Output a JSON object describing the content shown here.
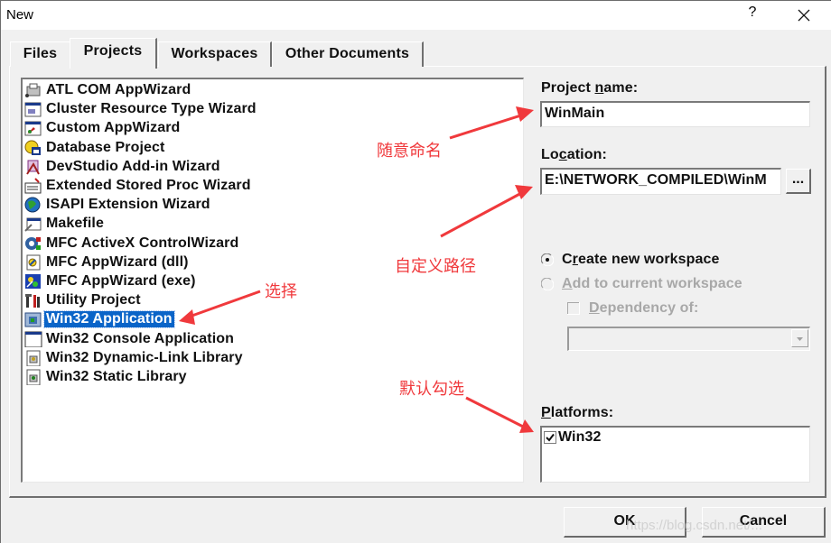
{
  "window": {
    "title": "New",
    "help_glyph": "?",
    "close_icon": "close-icon"
  },
  "tabs": [
    {
      "label": "Files",
      "active": false
    },
    {
      "label": "Projects",
      "active": true
    },
    {
      "label": "Workspaces",
      "active": false
    },
    {
      "label": "Other Documents",
      "active": false
    }
  ],
  "project_types": [
    {
      "label": "ATL COM AppWizard",
      "icon": "atl-com-icon",
      "selected": false
    },
    {
      "label": "Cluster Resource Type Wizard",
      "icon": "cluster-resource-icon",
      "selected": false
    },
    {
      "label": "Custom AppWizard",
      "icon": "custom-appwizard-icon",
      "selected": false
    },
    {
      "label": "Database Project",
      "icon": "database-project-icon",
      "selected": false
    },
    {
      "label": "DevStudio Add-in Wizard",
      "icon": "devstudio-addin-icon",
      "selected": false
    },
    {
      "label": "Extended Stored Proc Wizard",
      "icon": "stored-proc-icon",
      "selected": false
    },
    {
      "label": "ISAPI Extension Wizard",
      "icon": "isapi-globe-icon",
      "selected": false
    },
    {
      "label": "Makefile",
      "icon": "makefile-icon",
      "selected": false
    },
    {
      "label": "MFC ActiveX ControlWizard",
      "icon": "mfc-activex-icon",
      "selected": false
    },
    {
      "label": "MFC AppWizard (dll)",
      "icon": "mfc-dll-icon",
      "selected": false
    },
    {
      "label": "MFC AppWizard (exe)",
      "icon": "mfc-exe-icon",
      "selected": false
    },
    {
      "label": "Utility Project",
      "icon": "utility-tools-icon",
      "selected": false
    },
    {
      "label": "Win32 Application",
      "icon": "win32-app-icon",
      "selected": true
    },
    {
      "label": "Win32 Console Application",
      "icon": "console-window-icon",
      "selected": false
    },
    {
      "label": "Win32 Dynamic-Link Library",
      "icon": "dll-library-icon",
      "selected": false
    },
    {
      "label": "Win32 Static Library",
      "icon": "static-library-icon",
      "selected": false
    }
  ],
  "form": {
    "project_name_label_pre": "Project ",
    "project_name_label_u": "n",
    "project_name_label_post": "ame:",
    "project_name_value": "WinMain",
    "location_label_pre": "Lo",
    "location_label_u": "c",
    "location_label_post": "ation:",
    "location_value": "E:\\NETWORK_COMPILED\\WinM",
    "browse_label": "...",
    "create_new_pre": "C",
    "create_new_u": "r",
    "create_new_post": "eate new workspace",
    "create_new_checked": true,
    "add_current_u": "A",
    "add_current_post": "dd to current workspace",
    "add_current_enabled": false,
    "dependency_u": "D",
    "dependency_post": "ependency of:",
    "dependency_checked": false,
    "dependency_combo_value": "",
    "platforms_label_u": "P",
    "platforms_label_post": "latforms:",
    "platforms": [
      {
        "label": "Win32",
        "checked": true
      }
    ]
  },
  "buttons": {
    "ok": "OK",
    "cancel": "Cancel"
  },
  "annotations": {
    "name_hint": "随意命名",
    "path_hint": "自定义路径",
    "select_hint": "选择",
    "default_hint": "默认勾选",
    "color": "#f0393c"
  },
  "watermark": "https://blog.csdn.net/..."
}
